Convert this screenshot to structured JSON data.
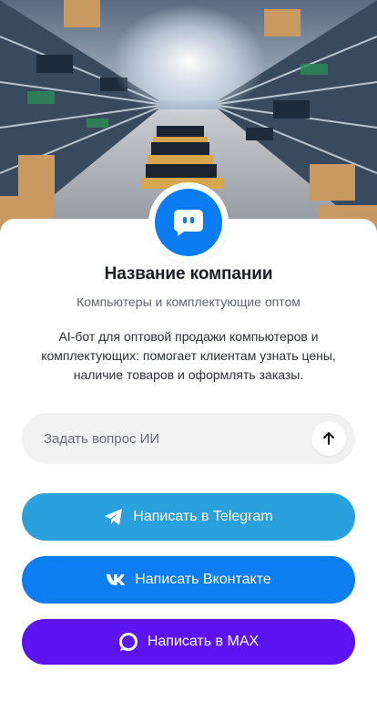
{
  "company": {
    "name": "Название компании",
    "tagline": "Компьютеры и комплектующие оптом",
    "description": "AI-бот для оптовой продажи компьютеров и комплектующих: помогает клиентам узнать цены, наличие товаров и оформлять заказы."
  },
  "ask": {
    "placeholder": "Задать вопрос ИИ",
    "value": ""
  },
  "buttons": {
    "telegram": "Написать в Telegram",
    "vkontakte": "Написать Вконтакте",
    "max": "Написать в MAX"
  },
  "icons": {
    "hero": "warehouse-image",
    "avatar": "bot-chat-icon",
    "send": "arrow-up-icon",
    "telegram": "telegram-icon",
    "vkontakte": "vk-icon",
    "max": "max-chat-icon"
  },
  "colors": {
    "avatar": "#0c7cf2",
    "telegram": "#2aa0dc",
    "vkontakte": "#0d7df2",
    "max": "#5d14f2",
    "input_bg": "#f1f1f2"
  }
}
